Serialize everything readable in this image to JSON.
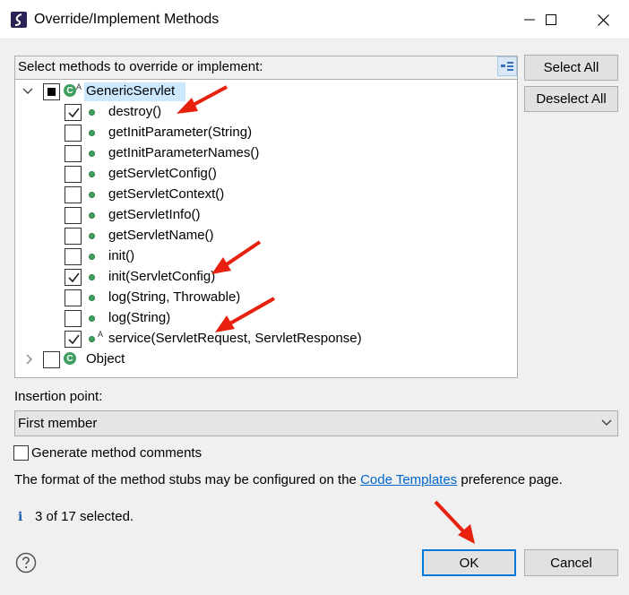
{
  "window": {
    "title": "Override/Implement Methods"
  },
  "tree": {
    "label": "Select methods to override or implement:",
    "root": {
      "label": "GenericServlet",
      "abstract_mark": "A",
      "methods": [
        {
          "label": "destroy()",
          "checked": true
        },
        {
          "label": "getInitParameter(String)",
          "checked": false
        },
        {
          "label": "getInitParameterNames()",
          "checked": false
        },
        {
          "label": "getServletConfig()",
          "checked": false
        },
        {
          "label": "getServletContext()",
          "checked": false
        },
        {
          "label": "getServletInfo()",
          "checked": false
        },
        {
          "label": "getServletName()",
          "checked": false
        },
        {
          "label": "init()",
          "checked": false
        },
        {
          "label": "init(ServletConfig)",
          "checked": true
        },
        {
          "label": "log(String, Throwable)",
          "checked": false
        },
        {
          "label": "log(String)",
          "checked": false
        },
        {
          "label": "service(ServletRequest, ServletResponse)",
          "checked": true,
          "abstract_mark": "A"
        }
      ]
    },
    "second": {
      "label": "Object"
    }
  },
  "buttons": {
    "select_all": "Select All",
    "deselect_all": "Deselect All",
    "ok": "OK",
    "cancel": "Cancel"
  },
  "insertion": {
    "label": "Insertion point:",
    "value": "First member"
  },
  "generate_comments": {
    "label": "Generate method comments",
    "checked": false
  },
  "info": {
    "prefix": "The format of the method stubs may be configured on the ",
    "link": "Code Templates",
    "suffix": " preference page."
  },
  "status": {
    "icon": "info-icon",
    "text": "3 of 17 selected."
  },
  "colors": {
    "accent": "#0078d7",
    "method_dot": "#3f9f5f",
    "selection": "#cce8ff",
    "annotation_arrow": "#e8200e",
    "link": "#0066cc"
  }
}
